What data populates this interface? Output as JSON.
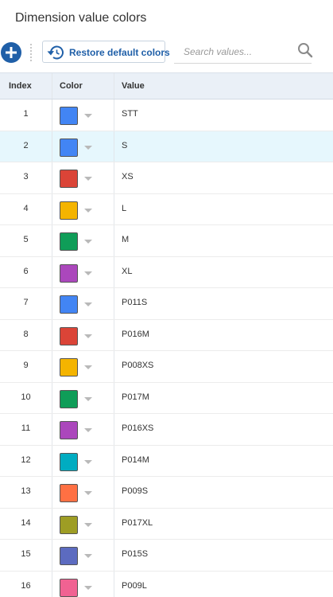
{
  "header": {
    "title": "Dimension value colors"
  },
  "toolbar": {
    "add_icon": "plus-icon",
    "restore_label": "Restore default colors",
    "restore_icon": "restore-icon"
  },
  "search": {
    "placeholder": "Search values...",
    "value": "",
    "icon": "search-icon"
  },
  "table": {
    "columns": [
      "Index",
      "Color",
      "Value"
    ],
    "selected_index": 2,
    "rows": [
      {
        "index": "1",
        "color": "#4285f4",
        "value": "STT"
      },
      {
        "index": "2",
        "color": "#4285f4",
        "value": "S"
      },
      {
        "index": "3",
        "color": "#db4437",
        "value": "XS"
      },
      {
        "index": "4",
        "color": "#f4b400",
        "value": "L"
      },
      {
        "index": "5",
        "color": "#0f9d58",
        "value": "M"
      },
      {
        "index": "6",
        "color": "#ab47bc",
        "value": "XL"
      },
      {
        "index": "7",
        "color": "#4285f4",
        "value": "P011S"
      },
      {
        "index": "8",
        "color": "#db4437",
        "value": "P016M"
      },
      {
        "index": "9",
        "color": "#f4b400",
        "value": "P008XS"
      },
      {
        "index": "10",
        "color": "#0f9d58",
        "value": "P017M"
      },
      {
        "index": "11",
        "color": "#ab47bc",
        "value": "P016XS"
      },
      {
        "index": "12",
        "color": "#00acc1",
        "value": "P014M"
      },
      {
        "index": "13",
        "color": "#ff7043",
        "value": "P009S"
      },
      {
        "index": "14",
        "color": "#9e9d24",
        "value": "P017XL"
      },
      {
        "index": "15",
        "color": "#5c6bc0",
        "value": "P015S"
      },
      {
        "index": "16",
        "color": "#f06292",
        "value": "P009L"
      }
    ]
  },
  "colors": {
    "accent": "#1f5fa8",
    "header_bg": "#eaf0f7",
    "selected_row_bg": "#e6f7fd"
  }
}
